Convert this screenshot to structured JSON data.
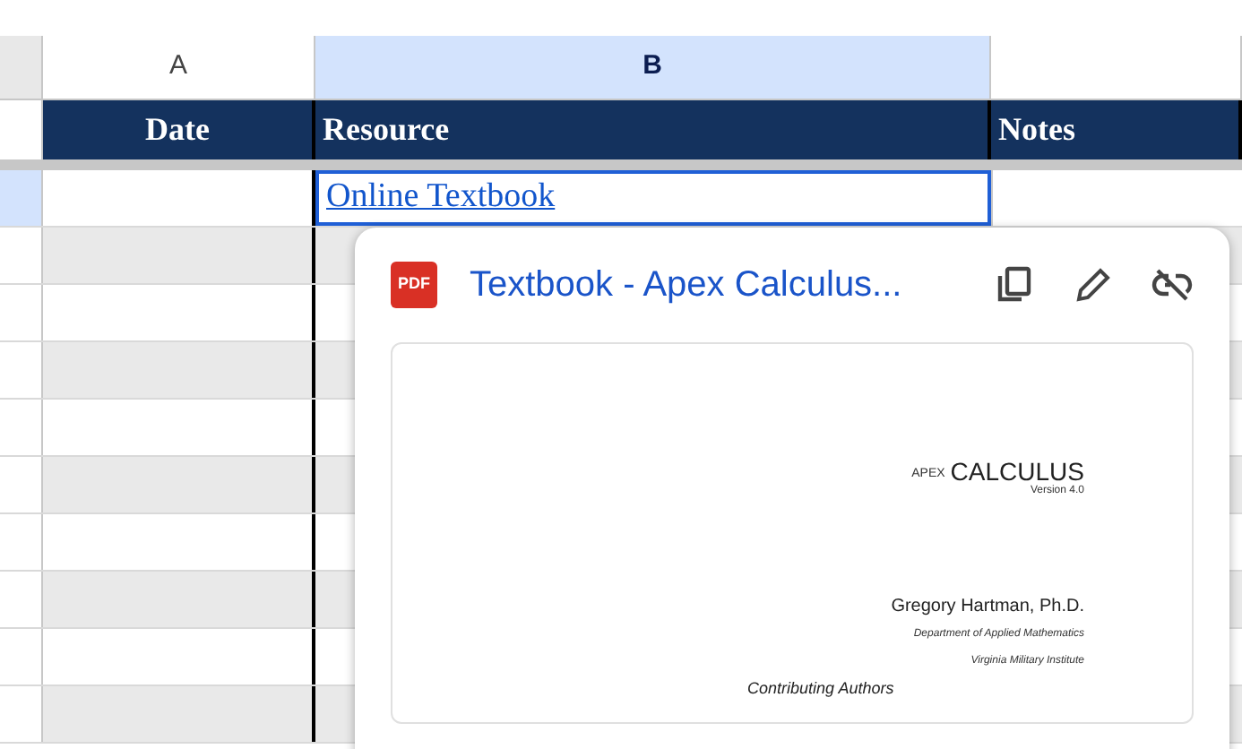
{
  "columns": [
    {
      "label": "A",
      "selected": false
    },
    {
      "label": "B",
      "selected": true
    },
    {
      "selected": false
    }
  ],
  "header_row": [
    "Date",
    "Resource",
    "Notes"
  ],
  "rows": [
    {
      "selected": true,
      "resource": "Online Textbook"
    },
    {
      "selected": false
    },
    {
      "selected": false
    },
    {
      "selected": false
    },
    {
      "selected": false
    },
    {
      "selected": false
    },
    {
      "selected": false
    },
    {
      "selected": false
    },
    {
      "selected": false
    },
    {
      "selected": false
    }
  ],
  "link_popup": {
    "file_type": "PDF",
    "title": "Textbook - Apex Calculus...",
    "preview": {
      "logo_prefix": "APEX",
      "logo": "CALCULUS",
      "version": "Version 4.0",
      "author": "Gregory Hartman, Ph.D.",
      "department": "Department of Applied Mathematics",
      "institute": "Virginia Military Institute",
      "section": "Contributing Authors"
    }
  }
}
